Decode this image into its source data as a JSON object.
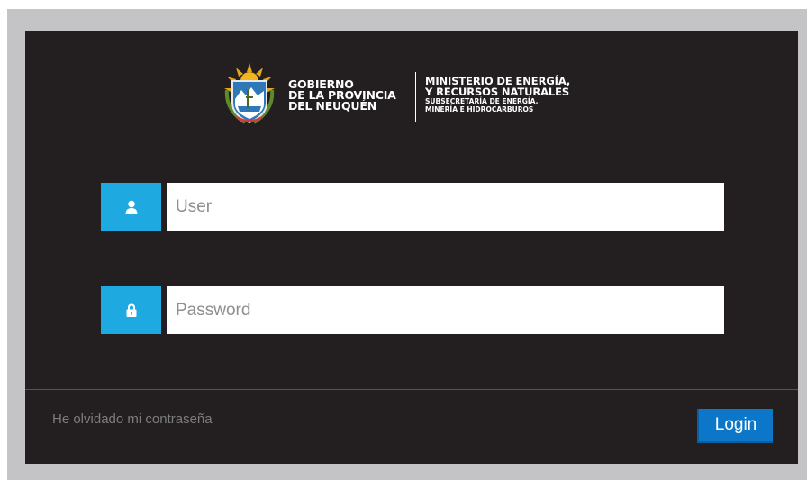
{
  "logo": {
    "gov_line1": "GOBIERNO",
    "gov_line2": "DE LA PROVINCIA",
    "gov_line3": "DEL NEUQUÉN",
    "ministry_line1": "MINISTERIO DE ENERGÍA,",
    "ministry_line2": "Y RECURSOS NATURALES",
    "sub_line1": "SUBSECRETARÍA DE ENERGÍA,",
    "sub_line2": "MINERÍA E HIDROCARBUROS"
  },
  "form": {
    "user_placeholder": "User",
    "user_value": "",
    "password_placeholder": "Password",
    "password_value": ""
  },
  "footer": {
    "forgot_label": "He olvidado mi contraseña",
    "login_label": "Login"
  },
  "icons": {
    "user": "user-icon",
    "password": "lock-icon"
  },
  "colors": {
    "panel_bg": "#231f20",
    "frame_bg": "#c4c4c6",
    "icon_bg": "#1fa9e1",
    "login_button": "#0c77c9",
    "link_text": "#7c7c7c"
  }
}
